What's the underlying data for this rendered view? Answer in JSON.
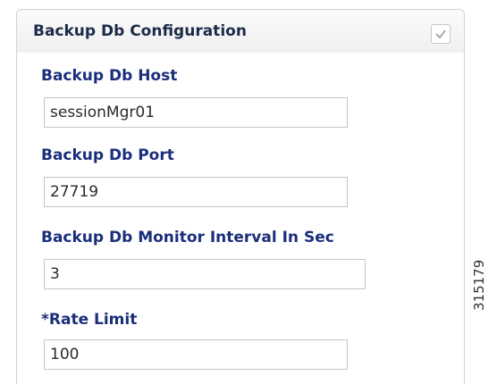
{
  "panel": {
    "title": "Backup Db Configuration",
    "header_checkbox": {
      "checked": true
    }
  },
  "fields": [
    {
      "label": "Backup Db Host",
      "value": "sessionMgr01"
    },
    {
      "label": "Backup Db Port",
      "value": "27719"
    },
    {
      "label": "Backup Db Monitor Interval In Sec",
      "value": "3"
    },
    {
      "label": "*Rate Limit",
      "value": "100"
    }
  ],
  "figure_id": "315179"
}
